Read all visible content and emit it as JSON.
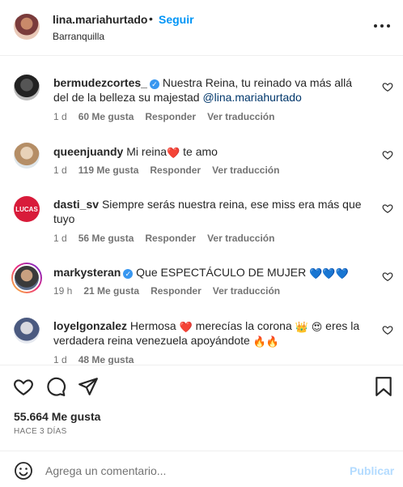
{
  "header": {
    "username": "lina.mariahurtado",
    "separator": "•",
    "follow_label": "Seguir",
    "location": "Barranquilla"
  },
  "comments": [
    {
      "username": "bermudezcortes_",
      "verified": true,
      "text": "Nuestra Reina, tu reinado va más allá del de la belleza su majestad ",
      "mention": "@lina.mariahurtado",
      "time": "1 d",
      "likes": "60 Me gusta",
      "reply": "Responder",
      "translate": "Ver traducción"
    },
    {
      "username": "queenjuandy",
      "verified": false,
      "text_before": "Mi reina",
      "emoji": "❤️",
      "text_after": " te amo",
      "time": "1 d",
      "likes": "119 Me gusta",
      "reply": "Responder",
      "translate": "Ver traducción"
    },
    {
      "username": "dasti_sv",
      "verified": false,
      "avatar_text": "LUCAS",
      "text": "Siempre serás nuestra reina, ese miss era más que tuyo",
      "time": "1 d",
      "likes": "56 Me gusta",
      "reply": "Responder",
      "translate": "Ver traducción"
    },
    {
      "username": "markysteran",
      "verified": true,
      "text": "Que ESPECTÁCULO DE MUJER ",
      "emoji": "💙💙💙",
      "time": "19 h",
      "likes": "21 Me gusta",
      "reply": "Responder",
      "translate": "Ver traducción"
    },
    {
      "username": "loyelgonzalez",
      "verified": false,
      "text_1": "Hermosa ",
      "emoji_1": "❤️",
      "text_2": " merecías la corona ",
      "emoji_2": "👑",
      "text_3": " ",
      "emoji_3": "😍",
      "text_4": " eres la verdadera reina venezuela apoyándote ",
      "emoji_4": "🔥🔥",
      "time": "1 d",
      "likes": "48 Me gusta"
    }
  ],
  "footer": {
    "likes": "55.664 Me gusta",
    "posted": "HACE 3 DÍAS",
    "comment_placeholder": "Agrega un comentario...",
    "publish_label": "Publicar"
  },
  "colors": {
    "link": "#0095f6",
    "verified": "#3897f0",
    "mention": "#00376b",
    "muted": "#737373",
    "publish_disabled": "#b3dbff"
  },
  "icons": [
    "more-icon",
    "heart-icon",
    "comment-icon",
    "share-icon",
    "bookmark-icon",
    "emoji-icon",
    "verified-icon"
  ]
}
